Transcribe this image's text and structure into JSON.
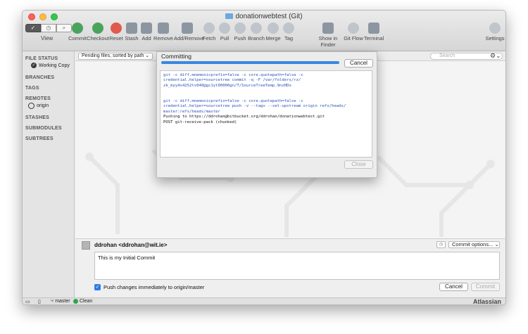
{
  "window": {
    "title": "donationwebtest (Git)"
  },
  "toolbar": {
    "view_label": "View",
    "items": [
      {
        "label": "Commit"
      },
      {
        "label": "Checkout"
      },
      {
        "label": "Reset"
      },
      {
        "label": "Stash"
      },
      {
        "label": "Add"
      },
      {
        "label": "Remove"
      },
      {
        "label": "Add/Remove"
      },
      {
        "label": "Fetch"
      },
      {
        "label": "Pull"
      },
      {
        "label": "Push"
      },
      {
        "label": "Branch"
      },
      {
        "label": "Merge"
      },
      {
        "label": "Tag"
      },
      {
        "label": "Show in Finder"
      },
      {
        "label": "Git Flow"
      },
      {
        "label": "Terminal"
      },
      {
        "label": "Settings"
      }
    ]
  },
  "sidebar": {
    "file_status": "FILE STATUS",
    "working_copy": "Working Copy",
    "branches": "BRANCHES",
    "tags": "TAGS",
    "remotes": "REMOTES",
    "origin": "origin",
    "stashes": "STASHES",
    "submodules": "SUBMODULES",
    "subtrees": "SUBTREES"
  },
  "filterbar": {
    "sort_select": "Pending files, sorted by path",
    "search_placeholder": "Search"
  },
  "dialog": {
    "title": "Committing",
    "progress": 1.0,
    "cancel_label": "Cancel",
    "close_label": "Close",
    "console_lines": [
      {
        "text": "git -c diff.mnemonicprefix=false -c core.quotepath=false -c",
        "kind": "cmd"
      },
      {
        "text": "credential.helper=sourcetree commit -q -F /var/folders/rz/",
        "kind": "cmd"
      },
      {
        "text": "zk_myy4x4252ts040@gc1yt00000gn/T/SourceTreeTemp.9nzHDo",
        "kind": "cmd"
      },
      {
        "text": "",
        "kind": "out"
      },
      {
        "text": "",
        "kind": "out"
      },
      {
        "text": "git -c diff.mnemonicprefix=false -c core.quotepath=false -c",
        "kind": "cmd"
      },
      {
        "text": "credential.helper=sourcetree push -v --tags --set-upstream origin refs/heads/",
        "kind": "cmd"
      },
      {
        "text": "master:refs/heads/master",
        "kind": "cmd"
      },
      {
        "text": "Pushing to https://ddrohan@bitbucket.org/ddrohan/donationwebtest.git",
        "kind": "out"
      },
      {
        "text": "POST git-receive-pack (chunked)",
        "kind": "out"
      }
    ]
  },
  "commit": {
    "author": "ddrohan <ddrohan@wit.ie>",
    "options_label": "Commit options...",
    "message": "This is my Initial Commit",
    "push_label": "Push changes immediately to origin/master",
    "push_checked": true,
    "cancel_label": "Cancel",
    "commit_label": "Commit"
  },
  "statusbar": {
    "branch": "master",
    "state": "Clean",
    "brand": "Atlassian"
  }
}
